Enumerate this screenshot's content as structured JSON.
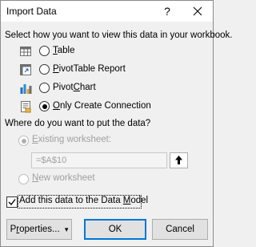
{
  "window": {
    "title": "Import Data",
    "help_label": "?"
  },
  "view_section": {
    "heading": "Select how you want to view this data in your workbook.",
    "options": [
      {
        "pre": "",
        "mnemonic": "T",
        "post": "able",
        "selected": false,
        "icon": "table-icon"
      },
      {
        "pre": "",
        "mnemonic": "P",
        "post": "ivotTable Report",
        "selected": false,
        "icon": "pivottable-icon"
      },
      {
        "pre": "Pivot",
        "mnemonic": "C",
        "post": "hart",
        "selected": false,
        "icon": "pivotchart-icon"
      },
      {
        "pre": "",
        "mnemonic": "O",
        "post": "nly Create Connection",
        "selected": true,
        "icon": "connection-icon"
      }
    ]
  },
  "location_section": {
    "heading": "Where do you want to put the data?",
    "existing_worksheet": {
      "pre": "",
      "mnemonic": "E",
      "post": "xisting worksheet:",
      "selected": true,
      "enabled": false
    },
    "cell_reference": "=$A$10",
    "new_worksheet": {
      "pre": "",
      "mnemonic": "N",
      "post": "ew worksheet",
      "selected": false,
      "enabled": false
    }
  },
  "data_model": {
    "pre": "Add this data to the Data ",
    "mnemonic": "M",
    "post": "odel",
    "checked": true
  },
  "buttons": {
    "properties": {
      "pre": "P",
      "mnemonic": "r",
      "post": "operties...",
      "arrow": "▾"
    },
    "ok": "OK",
    "cancel": "Cancel"
  },
  "colors": {
    "accent": "#0078d7",
    "background": "#f0f0f0",
    "disabled_text": "#a0a0a0"
  }
}
